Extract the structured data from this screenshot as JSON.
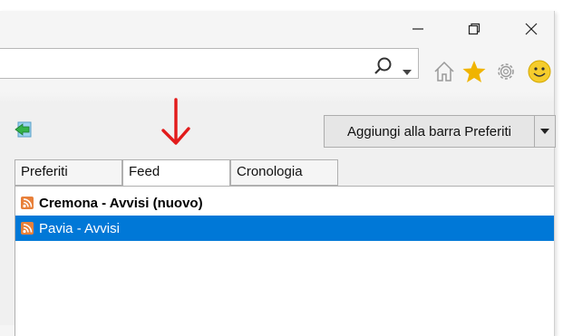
{
  "window": {
    "minimize_label": "—",
    "restore_label": "❐",
    "close_label": "✕"
  },
  "toolbar": {
    "search_icon": "search-icon",
    "dropdown_icon": "chevron-down-icon",
    "icons": [
      "home-icon",
      "star-icon",
      "gear-icon",
      "smiley-icon"
    ],
    "colors": {
      "star": "#f0b400",
      "smiley": "#f5cc2c"
    }
  },
  "favorites_panel": {
    "back_icon": "back-arrow-icon",
    "add_to_bar_button": "Aggiungi alla barra Preferiti",
    "tabs": [
      {
        "label": "Preferiti",
        "active": false
      },
      {
        "label": "Feed",
        "active": true
      },
      {
        "label": "Cronologia",
        "active": false
      }
    ],
    "feeds": [
      {
        "label": "Cremona - Avvisi (nuovo)",
        "bold": true,
        "selected": false
      },
      {
        "label": "Pavia - Avvisi",
        "bold": false,
        "selected": true
      }
    ],
    "colors": {
      "selection": "#0078d7",
      "rss": "#e8803a",
      "annotation_arrow": "#e21b1b"
    }
  }
}
